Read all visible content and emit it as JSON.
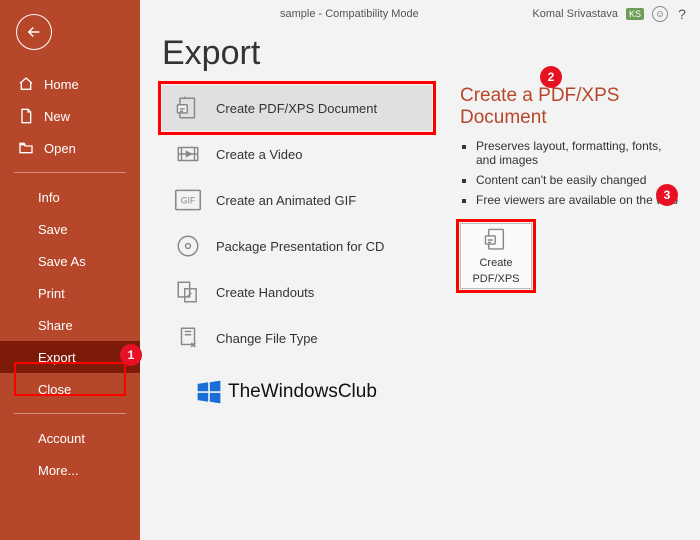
{
  "titlebar": {
    "document_title": "sample  -  Compatibility Mode",
    "user_name": "Komal Srivastava",
    "user_initials": "KS"
  },
  "sidebar": {
    "items": [
      {
        "label": "Home",
        "icon": "home-icon",
        "has_icon": true
      },
      {
        "label": "New",
        "icon": "new-file-icon",
        "has_icon": true
      },
      {
        "label": "Open",
        "icon": "open-folder-icon",
        "has_icon": true
      },
      {
        "label": "Info",
        "has_icon": false
      },
      {
        "label": "Save",
        "has_icon": false
      },
      {
        "label": "Save As",
        "has_icon": false
      },
      {
        "label": "Print",
        "has_icon": false
      },
      {
        "label": "Share",
        "has_icon": false
      },
      {
        "label": "Export",
        "has_icon": false,
        "active": true
      },
      {
        "label": "Close",
        "has_icon": false
      },
      {
        "label": "Account",
        "has_icon": false
      },
      {
        "label": "More...",
        "has_icon": false
      }
    ]
  },
  "page": {
    "title": "Export",
    "options": [
      {
        "label": "Create PDF/XPS Document",
        "icon": "doc-pdf-icon",
        "selected": true
      },
      {
        "label": "Create a Video",
        "icon": "video-icon"
      },
      {
        "label": "Create an Animated GIF",
        "icon": "gif-icon"
      },
      {
        "label": "Package Presentation for CD",
        "icon": "cd-icon"
      },
      {
        "label": "Create Handouts",
        "icon": "handouts-icon"
      },
      {
        "label": "Change File Type",
        "icon": "change-type-icon"
      }
    ],
    "details": {
      "heading": "Create a PDF/XPS Document",
      "bullets": [
        "Preserves layout, formatting, fonts, and images",
        "Content can't be easily changed",
        "Free viewers are available on the web"
      ],
      "button_line1": "Create",
      "button_line2": "PDF/XPS"
    }
  },
  "watermark": {
    "text": "TheWindowsClub"
  },
  "annotations": {
    "n1": "1",
    "n2": "2",
    "n3": "3"
  }
}
